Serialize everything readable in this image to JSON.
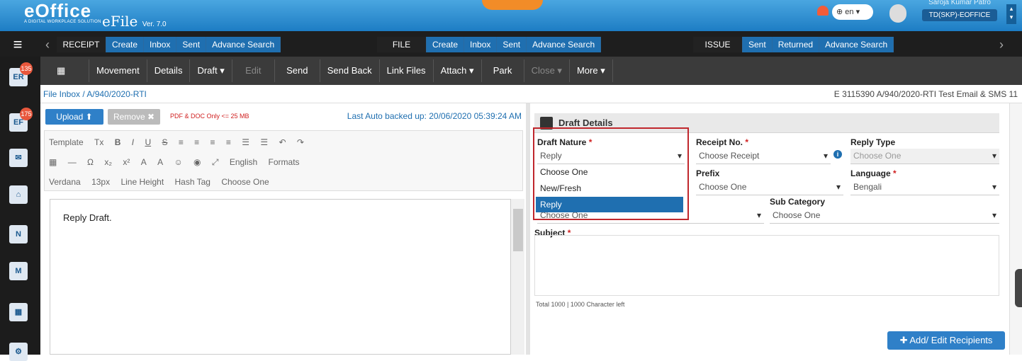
{
  "app": {
    "logo": "eOffice",
    "logo_sub": "A DIGITAL WORKPLACE SOLUTION",
    "title": "eFile",
    "version": "Ver. 7.0"
  },
  "topbar": {
    "lang": "en",
    "user_name": "Saroja Kumar Patro",
    "user_role": "TD(SKP)-EOFFICE"
  },
  "nav": {
    "receipt": {
      "label": "RECEIPT",
      "items": [
        "Create",
        "Inbox",
        "Sent",
        "Advance Search"
      ]
    },
    "file": {
      "label": "FILE",
      "items": [
        "Create",
        "Inbox",
        "Sent",
        "Advance Search"
      ]
    },
    "issue": {
      "label": "ISSUE",
      "items": [
        "Sent",
        "Returned",
        "Advance Search"
      ]
    }
  },
  "toolbar": {
    "movement": "Movement",
    "details": "Details",
    "draft": "Draft",
    "edit": "Edit",
    "send": "Send",
    "send_back": "Send Back",
    "link_files": "Link Files",
    "attach": "Attach",
    "park": "Park",
    "close": "Close",
    "more": "More"
  },
  "sidebar": {
    "badge1": "135",
    "badge2": "175"
  },
  "breadcrumb": {
    "path": "File Inbox / A/940/2020-RTI",
    "right": "E 3115390 A/940/2020-RTI Test Email & SMS 11"
  },
  "upload": {
    "upload_label": "Upload",
    "remove_label": "Remove",
    "note": "PDF & DOC Only <= 25 MB",
    "autosave": "Last Auto backed up: 20/06/2020 05:39:24 AM"
  },
  "editor": {
    "row1": [
      "Template",
      "Tx",
      "B",
      "I",
      "U",
      "S",
      "≡",
      "≡",
      "≡",
      "≡",
      "☰",
      "☰",
      "↶",
      "↷"
    ],
    "row2": [
      "Ω",
      "x₂",
      "x²",
      "A",
      "A",
      "English",
      "Formats"
    ],
    "row3": [
      "Verdana",
      "13px",
      "Line Height",
      "Hash Tag",
      "Choose One"
    ],
    "content": "Reply Draft."
  },
  "draft": {
    "header": "Draft Details",
    "nature_label": "Draft Nature",
    "nature_value": "Reply",
    "nature_options": [
      "Choose One",
      "New/Fresh",
      "Reply"
    ],
    "receipt_label": "Receipt No.",
    "receipt_value": "Choose Receipt",
    "reply_type_label": "Reply Type",
    "reply_type_value": "Choose One",
    "prefix_label": "Prefix",
    "prefix_value": "Choose One",
    "language_label": "Language",
    "language_value": "Bengali",
    "category_value": "Choose One",
    "subcategory_label": "Sub Category",
    "subcategory_value": "Choose One",
    "subject_label": "Subject",
    "char_count": "Total 1000 | 1000 Character left",
    "recipients_button": "Add/ Edit Recipients"
  }
}
